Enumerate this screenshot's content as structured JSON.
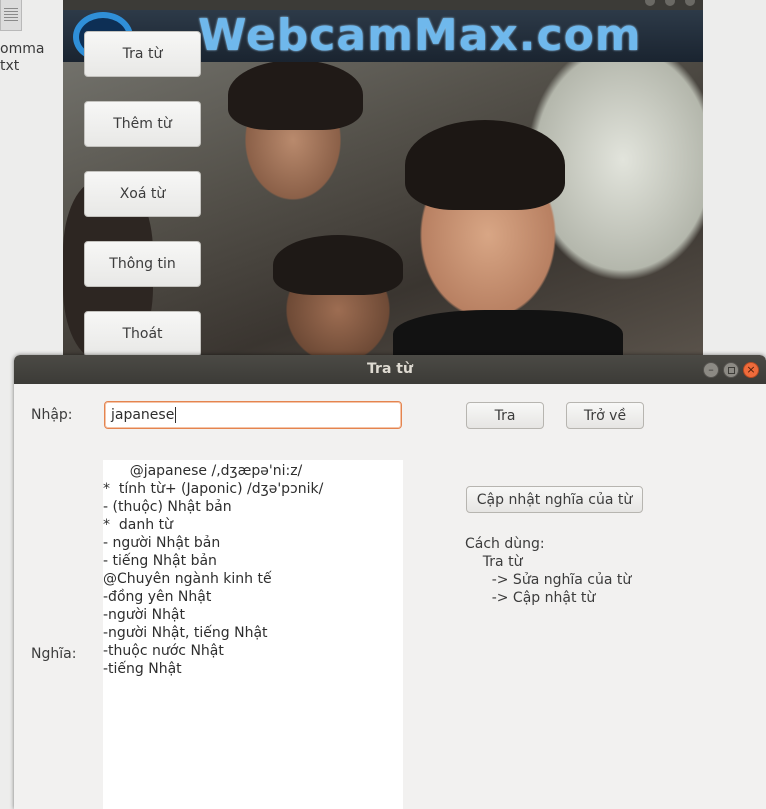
{
  "desktop": {
    "file_label": "omma\ntxt"
  },
  "main_window": {
    "banner_text": "WebcamMax.com",
    "menu": [
      {
        "label": "Tra từ"
      },
      {
        "label": "Thêm từ"
      },
      {
        "label": "Xoá từ"
      },
      {
        "label": "Thông tin"
      },
      {
        "label": "Thoát"
      }
    ]
  },
  "dialog": {
    "title": "Tra từ",
    "input_label": "Nhập:",
    "input_value": "japanese",
    "search_button": "Tra",
    "back_button": "Trở về",
    "meaning_label": "Nghĩa:",
    "meaning_lines": [
      "      @japanese /,dʒæpə'ni:z/",
      "*  tính từ+ (Japonic) /dʒə'pɔnik/",
      "- (thuộc) Nhật bản",
      "*  danh từ",
      "- người Nhật bản",
      "- tiếng Nhật bản",
      "@Chuyên ngành kinh tế",
      "-đồng yên Nhật",
      "-người Nhật",
      "-người Nhật, tiếng Nhật",
      "-thuộc nước Nhật",
      "-tiếng Nhật"
    ],
    "update_button": "Cập nhật nghĩa của từ",
    "usage_lines": [
      "Cách dùng:",
      "    Tra từ",
      "      -> Sửa nghĩa của từ",
      "      -> Cập nhật từ"
    ],
    "controls": {
      "minimize": "–",
      "close": "×"
    }
  },
  "colors": {
    "titlebar": "#3c3b37",
    "close_button": "#ef6b3b",
    "input_focus_border": "#e4844f"
  }
}
